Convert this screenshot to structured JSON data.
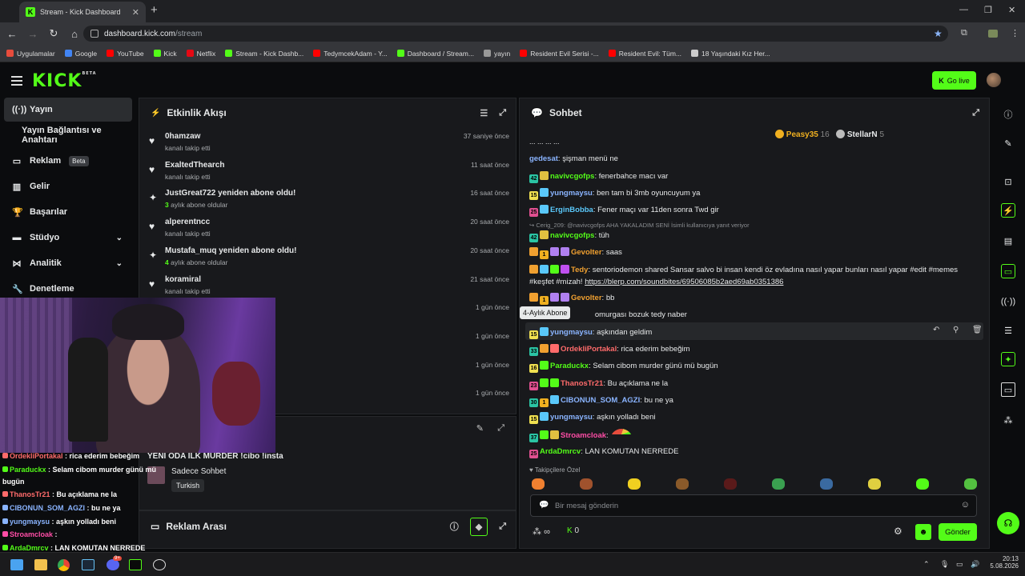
{
  "browser": {
    "tab_title": "Stream - Kick Dashboard",
    "url_domain": "dashboard.kick.com",
    "url_path": "/stream",
    "bookmarks": [
      {
        "label": "Uygulamalar",
        "color": "#e74c3c"
      },
      {
        "label": "Google",
        "color": "#4285f4"
      },
      {
        "label": "YouTube",
        "color": "#ff0000"
      },
      {
        "label": "Kick",
        "color": "#53fc18"
      },
      {
        "label": "Netflix",
        "color": "#e50914"
      },
      {
        "label": "Stream - Kick Dashb...",
        "color": "#53fc18"
      },
      {
        "label": "TedymcekAdam - Y...",
        "color": "#ff0000"
      },
      {
        "label": "Dashboard / Stream...",
        "color": "#53fc18"
      },
      {
        "label": "yayın",
        "color": "#999999"
      },
      {
        "label": "Resident Evil Serisi -...",
        "color": "#ff0000"
      },
      {
        "label": "Resident Evil: Tüm...",
        "color": "#ff0000"
      },
      {
        "label": "18 Yaşındaki Kız Her...",
        "color": "#cccccc"
      }
    ]
  },
  "header": {
    "logo": "KICK",
    "logo_sup": "BETA",
    "go_live": "Go live"
  },
  "sidebar": {
    "items": [
      {
        "label": "Yayın",
        "icon": "broadcast-icon"
      },
      {
        "label": "Yayın Bağlantısı ve Anahtarı"
      },
      {
        "label": "Reklam",
        "badge": "Beta",
        "icon": "ad-icon"
      },
      {
        "label": "Gelir",
        "icon": "chart-icon"
      },
      {
        "label": "Başarılar",
        "icon": "trophy-icon"
      },
      {
        "label": "Stüdyo",
        "icon": "studio-icon"
      },
      {
        "label": "Analitik",
        "icon": "analytics-icon"
      },
      {
        "label": "Denetleme",
        "icon": "moderation-icon"
      }
    ]
  },
  "activity": {
    "title": "Etkinlik Akışı",
    "items": [
      {
        "name": "0hamzaw",
        "sub": "kanalı takip etti",
        "time": "37 saniye önce",
        "kind": "follow"
      },
      {
        "name": "ExaltedThearch",
        "sub": "kanalı takip etti",
        "time": "11 saat önce",
        "kind": "follow"
      },
      {
        "name": "JustGreat722 yeniden abone oldu!",
        "months": "3",
        "sub": "aylık abone oldular",
        "time": "16 saat önce",
        "kind": "sub"
      },
      {
        "name": "alperentncc",
        "sub": "kanalı takip etti",
        "time": "20 saat önce",
        "kind": "follow"
      },
      {
        "name": "Mustafa_muq yeniden abone oldu!",
        "months": "4",
        "sub": "aylık abone oldular",
        "time": "20 saat önce",
        "kind": "sub"
      },
      {
        "name": "koramiral",
        "sub": "kanalı takip etti",
        "time": "21 saat önce",
        "kind": "follow"
      },
      {
        "name": "",
        "sub": "",
        "time": "1 gün önce",
        "kind": "follow"
      },
      {
        "name": "",
        "sub": "",
        "time": "1 gün önce",
        "kind": "follow"
      },
      {
        "name": "",
        "sub": "",
        "time": "1 gün önce",
        "kind": "follow"
      },
      {
        "name": "!",
        "sub": "",
        "time": "1 gün önce",
        "kind": "sub"
      }
    ]
  },
  "stream_info": {
    "title": "YENİ ODA İLK MURDER !cibo !insta",
    "mode": "Sadece Sohbet",
    "language": "Turkish"
  },
  "ad_break": {
    "title": "Reklam Arası"
  },
  "chat": {
    "title": "Sohbet",
    "top_supporters": [
      {
        "name": "Peasy35",
        "count": "16"
      },
      {
        "name": "StellarN",
        "count": "5"
      }
    ],
    "partial_top": "... ... ... ...",
    "messages": [
      {
        "user": "gedesat",
        "color": "#8ab4ff",
        "text": "şişman menü ne",
        "badges": []
      },
      {
        "user": "navivcgofps",
        "color": "#53fc18",
        "text": "fenerbahce macı var",
        "badges": [
          {
            "t": "42",
            "c": "#2bc4a4"
          },
          {
            "t": "",
            "c": "#e0c040"
          }
        ]
      },
      {
        "user": "yungmaysu",
        "color": "#8ab4ff",
        "text": "ben tam bi 3mb oyuncuyum ya",
        "badges": [
          {
            "t": "15",
            "c": "#f0e050"
          },
          {
            "t": "",
            "c": "#5ac8fa"
          }
        ]
      },
      {
        "user": "ErginBobba",
        "color": "#5ac8fa",
        "text": "Fener maçı var 11den sonra Twd gir",
        "badges": [
          {
            "t": "25",
            "c": "#e05090"
          },
          {
            "t": "",
            "c": "#5ac8fa"
          }
        ]
      },
      {
        "user": "navivcgofps",
        "color": "#53fc18",
        "text": "tüh",
        "badges": [
          {
            "t": "42",
            "c": "#2bc4a4"
          },
          {
            "t": "",
            "c": "#e0c040"
          }
        ],
        "reply": "Cerig_209: @navivcgofps AHA YAKALADIM SENİ İsimli kullanıcıya yanıt veriyor"
      },
      {
        "user": "Gevolter",
        "color": "#f0a030",
        "text": "saas",
        "badges": [
          {
            "t": "",
            "c": "#f0a030"
          },
          {
            "t": "1",
            "c": "#f0b020"
          },
          {
            "t": "",
            "c": "#b080f0"
          },
          {
            "t": "",
            "c": "#b080f0"
          }
        ]
      },
      {
        "user": "Tedy",
        "color": "#f0a030",
        "text": "sentoriodemon shared Sansar salvo bi insan kendi öz evladına nasıl yapar bunları nasıl yapar #edit #memes #keşfet #mizah!",
        "link": "https://blerp.com/soundbites/69506085b2aed69ab0351386",
        "badges": [
          {
            "t": "",
            "c": "#f0a030"
          },
          {
            "t": "",
            "c": "#5ac8fa"
          },
          {
            "t": "",
            "c": "#53fc18"
          },
          {
            "t": "",
            "c": "#c050f0"
          }
        ]
      },
      {
        "user": "Gevolter",
        "color": "#f0a030",
        "text": "bb",
        "badges": [
          {
            "t": "",
            "c": "#f0a030"
          },
          {
            "t": "1",
            "c": "#f0b020"
          },
          {
            "t": "",
            "c": "#b080f0"
          },
          {
            "t": "",
            "c": "#b080f0"
          }
        ]
      },
      {
        "user": "",
        "color": "#8ab4ff",
        "text": "omurgası bozuk tedy naber",
        "badges": []
      },
      {
        "user": "yungmaysu",
        "color": "#8ab4ff",
        "text": "aşkından geldim",
        "badges": [
          {
            "t": "15",
            "c": "#f0e050"
          },
          {
            "t": "",
            "c": "#5ac8fa"
          }
        ]
      },
      {
        "user": "OrdekliPortakal",
        "color": "#ff6b6b",
        "text": "rica ederim bebeğim",
        "badges": [
          {
            "t": "33",
            "c": "#2bc4a4"
          },
          {
            "t": "",
            "c": "#f0a030"
          },
          {
            "t": "",
            "c": "#ff6b6b"
          }
        ]
      },
      {
        "user": "Paraduckx",
        "color": "#53fc18",
        "text": "Selam cibom murder günü mü bugün",
        "badges": [
          {
            "t": "16",
            "c": "#f0e050"
          },
          {
            "t": "",
            "c": "#53fc18"
          }
        ]
      },
      {
        "user": "ThanosTr21",
        "color": "#ff6b6b",
        "text": "Bu açıklama ne la",
        "badges": [
          {
            "t": "23",
            "c": "#e05090"
          },
          {
            "t": "",
            "c": "#53fc18"
          },
          {
            "t": "",
            "c": "#53fc18"
          }
        ]
      },
      {
        "user": "CIBONUN_SOM_AGZI",
        "color": "#8ab4ff",
        "text": "bu ne ya",
        "badges": [
          {
            "t": "30",
            "c": "#2bc4a4"
          },
          {
            "t": "1",
            "c": "#f0b020"
          },
          {
            "t": "",
            "c": "#5ac8fa"
          }
        ]
      },
      {
        "user": "yungmaysu",
        "color": "#8ab4ff",
        "text": "aşkın yolladı beni",
        "badges": [
          {
            "t": "15",
            "c": "#f0e050"
          },
          {
            "t": "",
            "c": "#5ac8fa"
          }
        ]
      },
      {
        "user": "Stroamcloak",
        "color": "#ff4da6",
        "text": "",
        "badges": [
          {
            "t": "37",
            "c": "#2bc4a4"
          },
          {
            "t": "",
            "c": "#53fc18"
          },
          {
            "t": "",
            "c": "#e0c040"
          }
        ]
      },
      {
        "user": "ArdaDmrcv",
        "color": "#53fc18",
        "text": "LAN KOMUTAN NERREDE",
        "badges": [
          {
            "t": "25",
            "c": "#e05090"
          }
        ]
      }
    ],
    "tooltip": "4-Aylık Abone",
    "followers_only": "Takipçilere Özel",
    "input_placeholder": "Bir mesaj gönderin",
    "points": "0",
    "send": "Gönder",
    "viewers_symbol": "∞"
  },
  "overlay_chat": [
    {
      "user": "OrdekliPortakal",
      "color": "#ff6b6b",
      "text": "rica ederim bebeğim"
    },
    {
      "user": "Paraduckx",
      "color": "#53fc18",
      "text": "Selam cibom murder günü mü"
    },
    {
      "user": "",
      "color": "#53fc18",
      "text": "bugün"
    },
    {
      "user": "ThanosTr21",
      "color": "#ff6b6b",
      "text": "Bu açıklama ne la"
    },
    {
      "user": "CIBONUN_SOM_AGZI",
      "color": "#8ab4ff",
      "text": "bu ne ya"
    },
    {
      "user": "yungmaysu",
      "color": "#8ab4ff",
      "text": "aşkın yolladı beni"
    },
    {
      "user": "Stroamcloak",
      "color": "#ff4da6",
      "text": ""
    },
    {
      "user": "ArdaDmrcv",
      "color": "#53fc18",
      "text": "LAN KOMUTAN NERREDE"
    }
  ],
  "taskbar": {
    "time": "20:13",
    "date": "5.08.2026",
    "chrome_notif": "9+"
  }
}
